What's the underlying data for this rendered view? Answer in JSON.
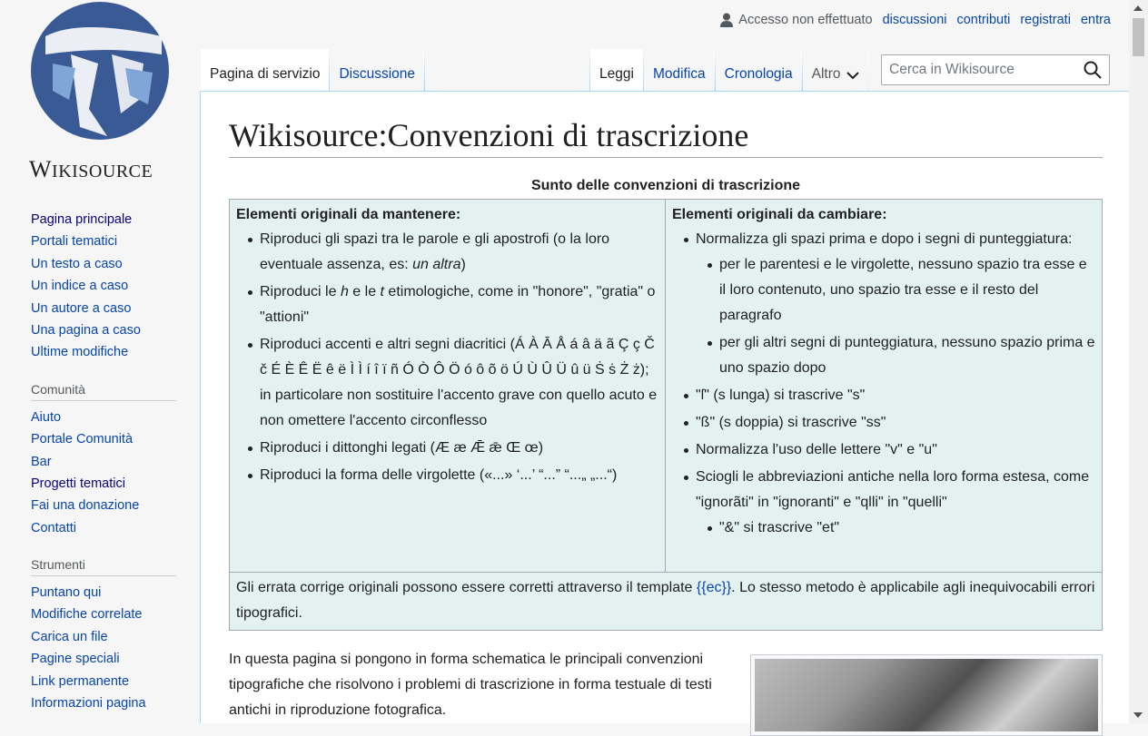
{
  "logo": {
    "wordmark": "Wikisource"
  },
  "personal": {
    "anon": "Accesso non effettuato",
    "links": [
      "discussioni",
      "contributi",
      "registrati",
      "entra"
    ]
  },
  "tabs": {
    "left": [
      "Pagina di servizio",
      "Discussione"
    ],
    "right": [
      "Leggi",
      "Modifica",
      "Cronologia",
      "Altro"
    ]
  },
  "search": {
    "placeholder": "Cerca in Wikisource"
  },
  "sidebar": {
    "main": [
      "Pagina principale",
      "Portali tematici",
      "Un testo a caso",
      "Un indice a caso",
      "Un autore a caso",
      "Una pagina a caso",
      "Ultime modifiche"
    ],
    "community": {
      "heading": "Comunità",
      "items": [
        "Aiuto",
        "Portale Comunità",
        "Bar",
        "Progetti tematici",
        "Fai una donazione",
        "Contatti"
      ]
    },
    "tools": {
      "heading": "Strumenti",
      "items": [
        "Puntano qui",
        "Modifiche correlate",
        "Carica un file",
        "Pagine speciali",
        "Link permanente",
        "Informazioni pagina"
      ]
    }
  },
  "page": {
    "title": "Wikisource:Convenzioni di trascrizione",
    "caption": "Sunto delle convenzioni di trascrizione",
    "col1": {
      "heading": "Elementi originali da mantenere:",
      "items": [
        {
          "text": "Riproduci gli spazi tra le parole e gli apostrofi (o la loro eventuale assenza, es: ",
          "italic": "un altra",
          "after": ")"
        },
        {
          "text": "Riproduci le ",
          "italic": "h",
          "after": " e le ",
          "italic2": "t",
          "after2": " etimologiche, come in \"honore\", \"gratia\" o \"attioni\""
        },
        {
          "text": "Riproduci accenti e altri segni diacritici (Á À Ā Å á â ä ã Ç ç Č č É È Ê Ë ê ë Ì Ì í î ï ñ Ó Ò Ô Ö ó ô õ ö Ú Ù Û Ü û ü Ṡ ṡ Ż ż); in particolare non sostituire l'accento grave con quello acuto e non omettere l'accento circonflesso"
        },
        {
          "text": "Riproduci i dittonghi legati (Æ æ Ǣ ǣ Œ œ)"
        },
        {
          "text": "Riproduci la forma delle virgolette («...» ‘...’ “...” “...„ „...“)"
        }
      ]
    },
    "col2": {
      "heading": "Elementi originali da cambiare:",
      "item1": "Normalizza gli spazi prima e dopo i segni di punteggiatura:",
      "sub1": [
        "per le parentesi e le virgolette, nessuno spazio tra esse e il loro contenuto, uno spazio tra esse e il resto del paragrafo",
        "per gli altri segni di punteggiatura, nessuno spazio prima e uno spazio dopo"
      ],
      "items": [
        "\"ſ\" (s lunga) si trascrive \"s\"",
        "\"ß\" (s doppia) si trascrive \"ss\"",
        "Normalizza l'uso delle lettere \"v\" e \"u\"",
        "Sciogli le abbreviazioni antiche nella loro forma estesa, come \"ignorãti\" in \"ignoranti\" e \"qlli\" in \"quelli\""
      ],
      "sub2": [
        "\"&\" si trascrive \"et\""
      ]
    },
    "footer": {
      "before": "Gli errata corrige originali possono essere corretti attraverso il template ",
      "link_open": "{{",
      "link": "ec",
      "link_close": "}}",
      "after": ". Lo stesso metodo è applicabile agli inequivocabili errori tipografici."
    },
    "intro": "In questa pagina si pongono in forma schematica le principali convenzioni tipografiche che risolvono i problemi di trascrizione in forma testuale di testi antichi in riproduzione fotografica."
  }
}
